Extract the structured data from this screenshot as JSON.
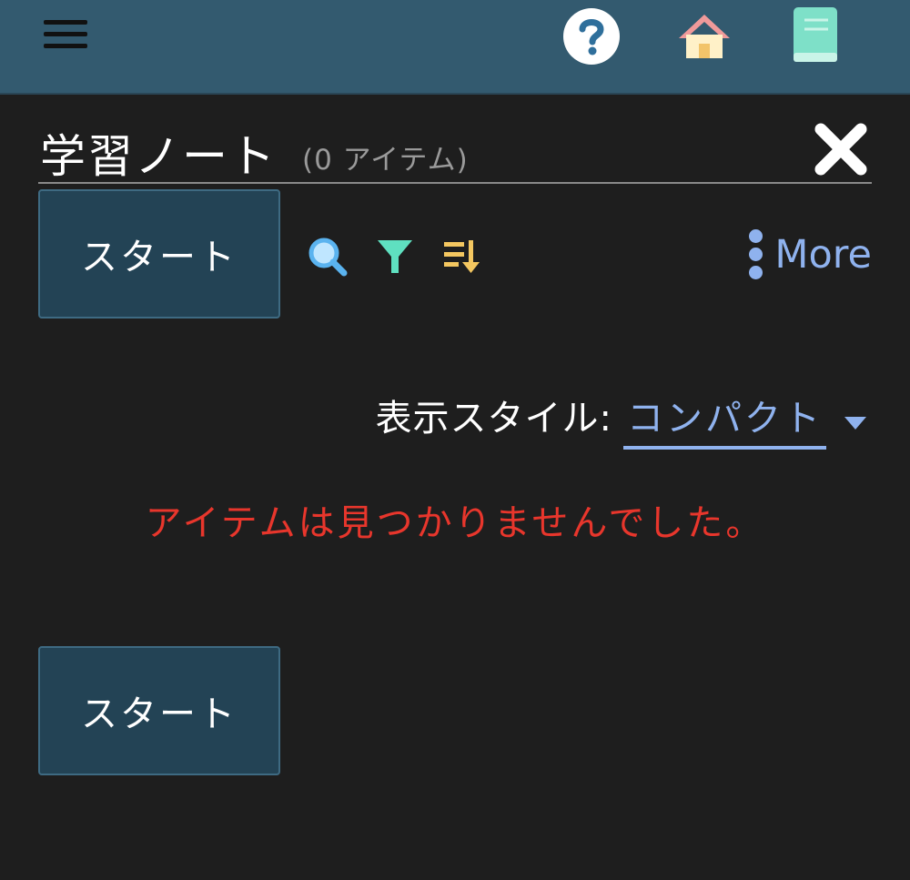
{
  "header": {
    "menu_icon": "hamburger-menu-icon",
    "help_icon": "question-circle-icon",
    "home_icon": "house-icon",
    "notebook_icon": "notebook-icon"
  },
  "panel": {
    "title": "学習ノート",
    "item_count": "(0 アイテム)",
    "close_icon": "close-x-icon"
  },
  "toolbar": {
    "start_label": "スタート",
    "search_icon": "magnifier-icon",
    "filter_icon": "filter-funnel-icon",
    "sort_icon": "sort-descending-icon",
    "more_label": "More"
  },
  "display_style": {
    "label": "表示スタイル:",
    "value": "コンパクト"
  },
  "empty_message": "アイテムは見つかりませんでした。",
  "footer": {
    "start_label": "スタート"
  },
  "colors": {
    "header_bg": "#335a6f",
    "panel_bg": "#1e1e1e",
    "button_bg": "#234355",
    "accent_blue": "#8fb2ee",
    "error_red": "#e8362c",
    "filter_teal": "#5fe0c0",
    "sort_orange": "#f4c760"
  }
}
